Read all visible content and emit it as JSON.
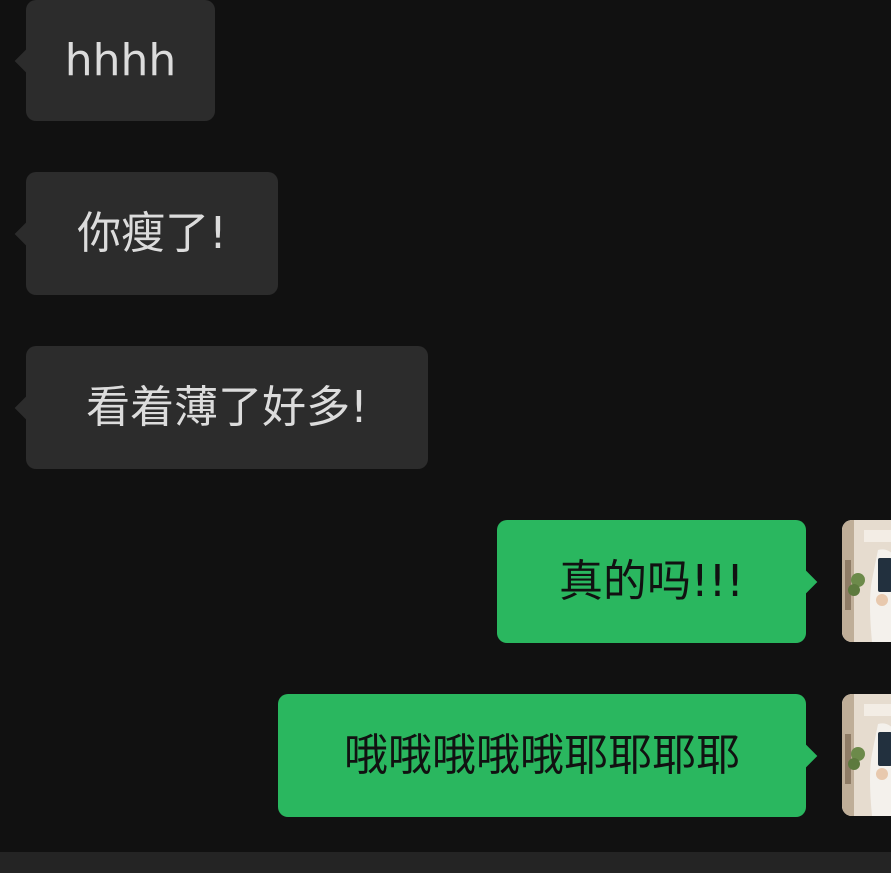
{
  "messages": {
    "incoming": [
      {
        "text": "hhhh"
      },
      {
        "text": "你瘦了!"
      },
      {
        "text": "看着薄了好多!"
      }
    ],
    "outgoing": [
      {
        "text": "真的吗!!!"
      },
      {
        "text": "哦哦哦哦哦耶耶耶耶"
      }
    ]
  },
  "colors": {
    "background": "#111111",
    "incoming_bubble": "#2c2c2c",
    "outgoing_bubble": "#2ab75f"
  },
  "icons": {
    "avatar": "user-avatar-photo"
  }
}
